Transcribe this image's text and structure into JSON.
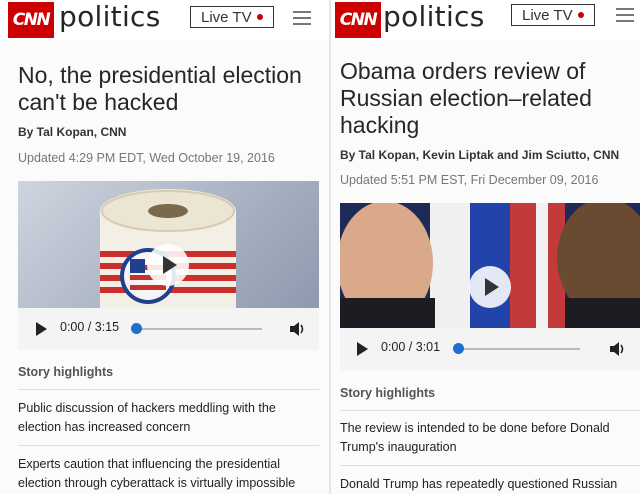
{
  "left": {
    "header": {
      "logo": "CNN",
      "section": "politics",
      "live_label": "Live TV"
    },
    "headline": "No, the presidential election can't be hacked",
    "byline": "By Tal Kopan, CNN",
    "updated": "Updated 4:29 PM EDT, Wed October 19, 2016",
    "video": {
      "time": "0:00 / 3:15",
      "progress": 0
    },
    "highlights": {
      "title": "Story highlights",
      "items": [
        "Public discussion of hackers meddling with the election has increased concern",
        "Experts caution that influencing the presidential election through cyberattack is virtually impossible"
      ]
    }
  },
  "right": {
    "header": {
      "logo": "CNN",
      "section": "politics",
      "live_label": "Live TV"
    },
    "headline": "Obama orders review of Russian election–related hacking",
    "byline": "By Tal Kopan, Kevin Liptak and Jim Sciutto, CNN",
    "updated": "Updated 5:51 PM EST, Fri December 09, 2016",
    "video": {
      "time": "0:00 / 3:01",
      "progress": 0
    },
    "highlights": {
      "title": "Story highlights",
      "items": [
        "The review is intended to be done before Donald Trump's inauguration",
        "Donald Trump has repeatedly questioned Russian"
      ]
    }
  },
  "colors": {
    "brand_red": "#cc0000",
    "progress_blue": "#1a6fd1"
  },
  "icons": [
    "cnn-logo",
    "live-dot-icon",
    "hamburger-menu-icon",
    "play-icon",
    "volume-icon"
  ]
}
